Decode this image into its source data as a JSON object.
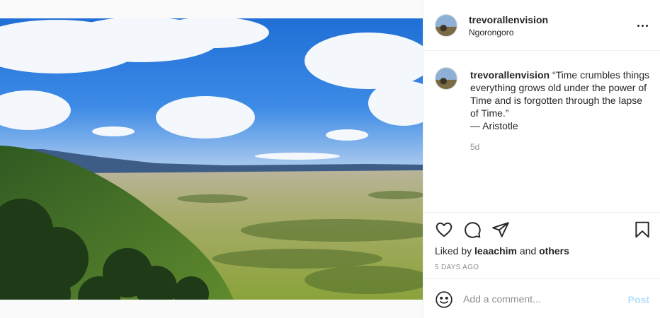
{
  "post": {
    "username": "trevorallenvision",
    "location": "Ngorongoro",
    "caption": "“Time crumbles things everything grows old under the power of Time and is forgotten through the lapse of Time.”\n— Aristotle",
    "age_short": "5d",
    "liked_by_prefix": "Liked by",
    "liked_by_user": "leaachim",
    "liked_by_and": "and",
    "liked_by_others": "others",
    "age_long": "5 DAYS AGO"
  },
  "comment": {
    "placeholder": "Add a comment...",
    "post_label": "Post"
  },
  "icons": {
    "more": "more-options-icon",
    "like": "heart-icon",
    "comment": "comment-icon",
    "share": "paper-plane-icon",
    "save": "bookmark-icon",
    "emoji": "emoji-icon"
  },
  "colors": {
    "text": "#262626",
    "muted": "#8e8e8e",
    "post_button": "#b2dffc",
    "border": "#efefef"
  }
}
